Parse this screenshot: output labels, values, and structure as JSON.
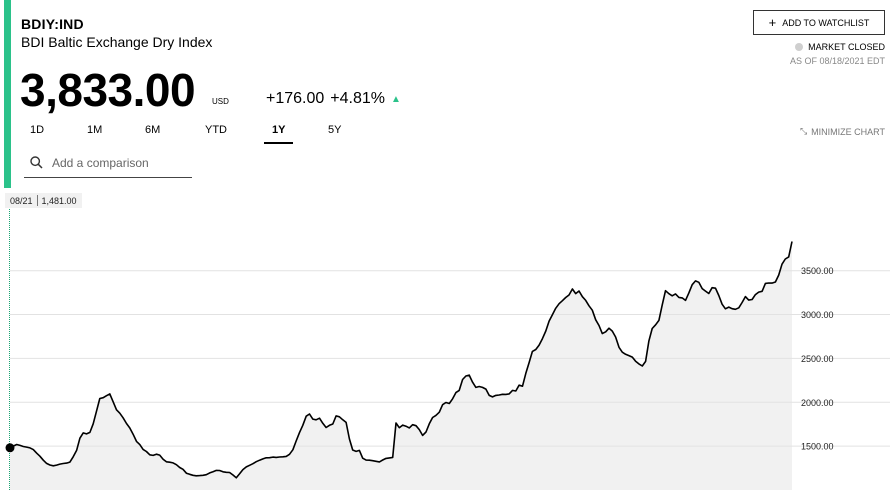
{
  "header": {
    "ticker": "BDIY:IND",
    "name": "BDI Baltic Exchange Dry Index",
    "price": "3,833.00",
    "currency": "USD",
    "change_abs": "+176.00",
    "change_pct": "+4.81%",
    "up_arrow": "▲"
  },
  "watchlist": {
    "plus": "+",
    "label": "ADD TO WATCHLIST"
  },
  "market": {
    "status": "MARKET CLOSED",
    "as_of": "AS OF 08/18/2021 EDT"
  },
  "ranges": [
    "1D",
    "1M",
    "6M",
    "YTD",
    "1Y",
    "5Y"
  ],
  "active_range": "1Y",
  "minimize_label": "MINIMIZE CHART",
  "comparison": {
    "placeholder": "Add a comparison"
  },
  "tooltip": {
    "date": "08/21",
    "value": "1,481.00"
  },
  "icons": {
    "search": "search-icon",
    "plus": "plus-icon",
    "compress": "compress-icon",
    "up_arrow": "up-arrow-icon",
    "status_dot": "status-dot-icon"
  },
  "colors": {
    "accent": "#2bc28a",
    "line": "#000000",
    "area": "#f1f1f1",
    "status_dot": "#cfcfcf"
  },
  "chart_data": {
    "type": "area",
    "ylim": [
      1000,
      3850
    ],
    "yticks": [
      1500,
      2000,
      2500,
      3000,
      3500
    ],
    "ytick_labels": [
      "1500.00",
      "2000.00",
      "2500.00",
      "3000.00",
      "3500.00"
    ],
    "grid": true,
    "x_index_range": [
      0,
      189
    ],
    "values": [
      1481,
      1500,
      1519,
      1508,
      1496,
      1489,
      1480,
      1460,
      1421,
      1385,
      1340,
      1303,
      1285,
      1276,
      1284,
      1295,
      1302,
      1307,
      1318,
      1378,
      1451,
      1591,
      1651,
      1640,
      1657,
      1755,
      1898,
      2043,
      2052,
      2075,
      2095,
      2004,
      1914,
      1876,
      1823,
      1758,
      1707,
      1636,
      1554,
      1518,
      1463,
      1439,
      1401,
      1395,
      1408,
      1398,
      1351,
      1321,
      1317,
      1309,
      1288,
      1257,
      1236,
      1192,
      1179,
      1168,
      1162,
      1164,
      1168,
      1174,
      1195,
      1209,
      1223,
      1222,
      1207,
      1202,
      1199,
      1171,
      1139,
      1185,
      1233,
      1263,
      1282,
      1300,
      1323,
      1340,
      1354,
      1367,
      1368,
      1375,
      1372,
      1376,
      1379,
      1383,
      1407,
      1459,
      1560,
      1654,
      1738,
      1841,
      1866,
      1808,
      1800,
      1818,
      1760,
      1712,
      1738,
      1752,
      1845,
      1834,
      1800,
      1771,
      1582,
      1456,
      1440,
      1451,
      1363,
      1341,
      1340,
      1334,
      1327,
      1320,
      1342,
      1360,
      1366,
      1372,
      1764,
      1710,
      1740,
      1727,
      1708,
      1744,
      1733,
      1689,
      1622,
      1661,
      1755,
      1827,
      1850,
      1887,
      1972,
      1998,
      1986,
      2040,
      2110,
      2136,
      2260,
      2300,
      2310,
      2230,
      2170,
      2180,
      2170,
      2150,
      2078,
      2061,
      2079,
      2083,
      2091,
      2090,
      2096,
      2135,
      2129,
      2195,
      2183,
      2329,
      2452,
      2580,
      2602,
      2652,
      2725,
      2813,
      2926,
      2998,
      3071,
      3124,
      3158,
      3194,
      3223,
      3291,
      3239,
      3269,
      3204,
      3161,
      3100,
      3050,
      2940,
      2875,
      2783,
      2804,
      2845,
      2811,
      2744,
      2627,
      2571,
      2547,
      2532,
      2515,
      2468,
      2437,
      2414,
      2466,
      2700,
      2841,
      2883,
      2934,
      3108,
      3272,
      3238,
      3214,
      3236,
      3196,
      3190,
      3162,
      3245,
      3340,
      3384,
      3368,
      3296,
      3268,
      3240,
      3306,
      3301,
      3217,
      3118,
      3066,
      3085,
      3067,
      3060,
      3077,
      3138,
      3205,
      3165,
      3172,
      3227,
      3256,
      3265,
      3355,
      3360,
      3359,
      3371,
      3450,
      3574,
      3633,
      3657,
      3833
    ]
  }
}
